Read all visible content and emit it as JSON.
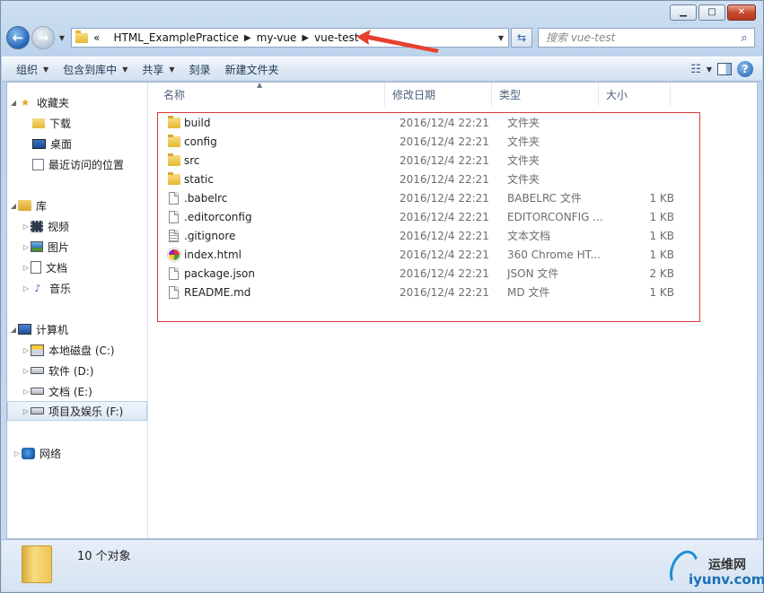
{
  "window": {
    "caption_buttons": [
      "minimize",
      "maximize",
      "close"
    ]
  },
  "address_bar": {
    "overflow_chevron": "«",
    "breadcrumbs": [
      "HTML_ExamplePractice",
      "my-vue",
      "vue-test"
    ]
  },
  "search": {
    "placeholder": "搜索 vue-test"
  },
  "toolbar": {
    "organize": "组织",
    "include_in_library": "包含到库中",
    "share": "共享",
    "burn": "刻录",
    "new_folder": "新建文件夹"
  },
  "nav_pane": {
    "favorites": {
      "label": "收藏夹",
      "items": [
        "下载",
        "桌面",
        "最近访问的位置"
      ]
    },
    "libraries": {
      "label": "库",
      "items": [
        "视频",
        "图片",
        "文档",
        "音乐"
      ]
    },
    "computer": {
      "label": "计算机",
      "items": [
        "本地磁盘 (C:)",
        "软件 (D:)",
        "文档 (E:)",
        "项目及娱乐 (F:)"
      ],
      "selected": "项目及娱乐 (F:)"
    },
    "network": {
      "label": "网络"
    }
  },
  "columns": {
    "name": "名称",
    "date": "修改日期",
    "type": "类型",
    "size": "大小"
  },
  "files": [
    {
      "name": "build",
      "date": "2016/12/4 22:21",
      "type": "文件夹",
      "size": "",
      "icon": "folder-icon"
    },
    {
      "name": "config",
      "date": "2016/12/4 22:21",
      "type": "文件夹",
      "size": "",
      "icon": "folder-icon"
    },
    {
      "name": "src",
      "date": "2016/12/4 22:21",
      "type": "文件夹",
      "size": "",
      "icon": "folder-icon"
    },
    {
      "name": "static",
      "date": "2016/12/4 22:21",
      "type": "文件夹",
      "size": "",
      "icon": "folder-icon"
    },
    {
      "name": ".babelrc",
      "date": "2016/12/4 22:21",
      "type": "BABELRC 文件",
      "size": "1 KB",
      "icon": "file-icon"
    },
    {
      "name": ".editorconfig",
      "date": "2016/12/4 22:21",
      "type": "EDITORCONFIG ...",
      "size": "1 KB",
      "icon": "file-icon"
    },
    {
      "name": ".gitignore",
      "date": "2016/12/4 22:21",
      "type": "文本文档",
      "size": "1 KB",
      "icon": "text-file-icon"
    },
    {
      "name": "index.html",
      "date": "2016/12/4 22:21",
      "type": "360 Chrome HT...",
      "size": "1 KB",
      "icon": "browser-icon"
    },
    {
      "name": "package.json",
      "date": "2016/12/4 22:21",
      "type": "JSON 文件",
      "size": "2 KB",
      "icon": "file-icon"
    },
    {
      "name": "README.md",
      "date": "2016/12/4 22:21",
      "type": "MD 文件",
      "size": "1 KB",
      "icon": "file-icon"
    }
  ],
  "status": {
    "item_count": "10 个对象"
  },
  "watermark": {
    "cn": "运维网",
    "en": "iyunv.com"
  },
  "colors": {
    "highlight_box": "#d9393a",
    "annotation_arrow": "#e8402e",
    "accent": "#1f5aa8"
  }
}
